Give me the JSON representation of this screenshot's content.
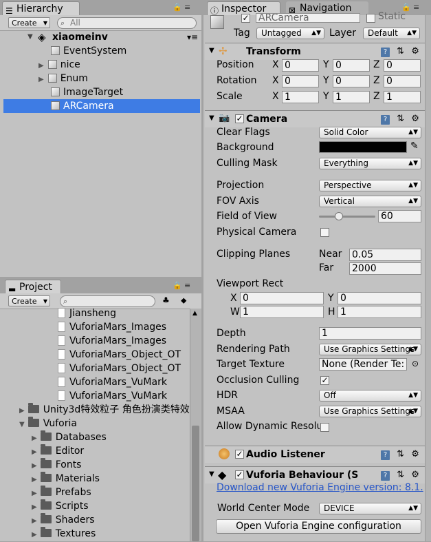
{
  "hierarchy": {
    "tab": "Hierarchy",
    "create": "Create",
    "search_placeholder": "All",
    "scene": "xiaomeinv",
    "items": [
      "EventSystem",
      "nice",
      "Enum",
      "ImageTarget",
      "ARCamera"
    ]
  },
  "project": {
    "tab": "Project",
    "create": "Create",
    "files": [
      "Jiansheng",
      "VuforiaMars_Images",
      "VuforiaMars_Images",
      "VuforiaMars_Object_OT",
      "VuforiaMars_Object_OT",
      "VuforiaMars_VuMark",
      "VuforiaMars_VuMark"
    ],
    "folders_top": [
      "Unity3d特效粒子 角色扮演类特效",
      "Vuforia"
    ],
    "folders_sub": [
      "Databases",
      "Editor",
      "Fonts",
      "Materials",
      "Prefabs",
      "Scripts",
      "Shaders",
      "Textures"
    ]
  },
  "inspector": {
    "tab": "Inspector",
    "tab2": "Navigation",
    "object_name": "ARCamera",
    "static_label": "Static",
    "tag_label": "Tag",
    "tag_value": "Untagged",
    "layer_label": "Layer",
    "layer_value": "Default",
    "transform": {
      "title": "Transform",
      "position": "Position",
      "rotation": "Rotation",
      "scale": "Scale",
      "x": "X",
      "y": "Y",
      "z": "Z",
      "pos": [
        "0",
        "0",
        "0"
      ],
      "rot": [
        "0",
        "0",
        "0"
      ],
      "scl": [
        "1",
        "1",
        "1"
      ]
    },
    "camera": {
      "title": "Camera",
      "clear_flags": "Clear Flags",
      "clear_flags_value": "Solid Color",
      "background": "Background",
      "background_color": "#000000",
      "culling_mask": "Culling Mask",
      "culling_mask_value": "Everything",
      "projection": "Projection",
      "projection_value": "Perspective",
      "fov_axis": "FOV Axis",
      "fov_axis_value": "Vertical",
      "fov": "Field of View",
      "fov_value": "60",
      "physical": "Physical Camera",
      "clipping": "Clipping Planes",
      "near": "Near",
      "near_value": "0.05",
      "far": "Far",
      "far_value": "2000",
      "viewport": "Viewport Rect",
      "vx": "X",
      "vx_value": "0",
      "vy": "Y",
      "vy_value": "0",
      "vw": "W",
      "vw_value": "1",
      "vh": "H",
      "vh_value": "1",
      "depth": "Depth",
      "depth_value": "1",
      "rendering_path": "Rendering Path",
      "rendering_path_value": "Use Graphics Settings",
      "target_texture": "Target Texture",
      "target_texture_value": "None (Render Te:",
      "occlusion": "Occlusion Culling",
      "hdr": "HDR",
      "hdr_value": "Off",
      "msaa": "MSAA",
      "msaa_value": "Use Graphics Settings",
      "dynamic": "Allow Dynamic Resolu"
    },
    "audio_listener": "Audio Listener",
    "vuforia": {
      "title": "Vuforia Behaviour (S",
      "download": "Download new Vuforia Engine version: 8.1.",
      "world_center": "World Center Mode",
      "world_center_value": "DEVICE",
      "open_config": "Open Vuforia Engine configuration"
    }
  }
}
